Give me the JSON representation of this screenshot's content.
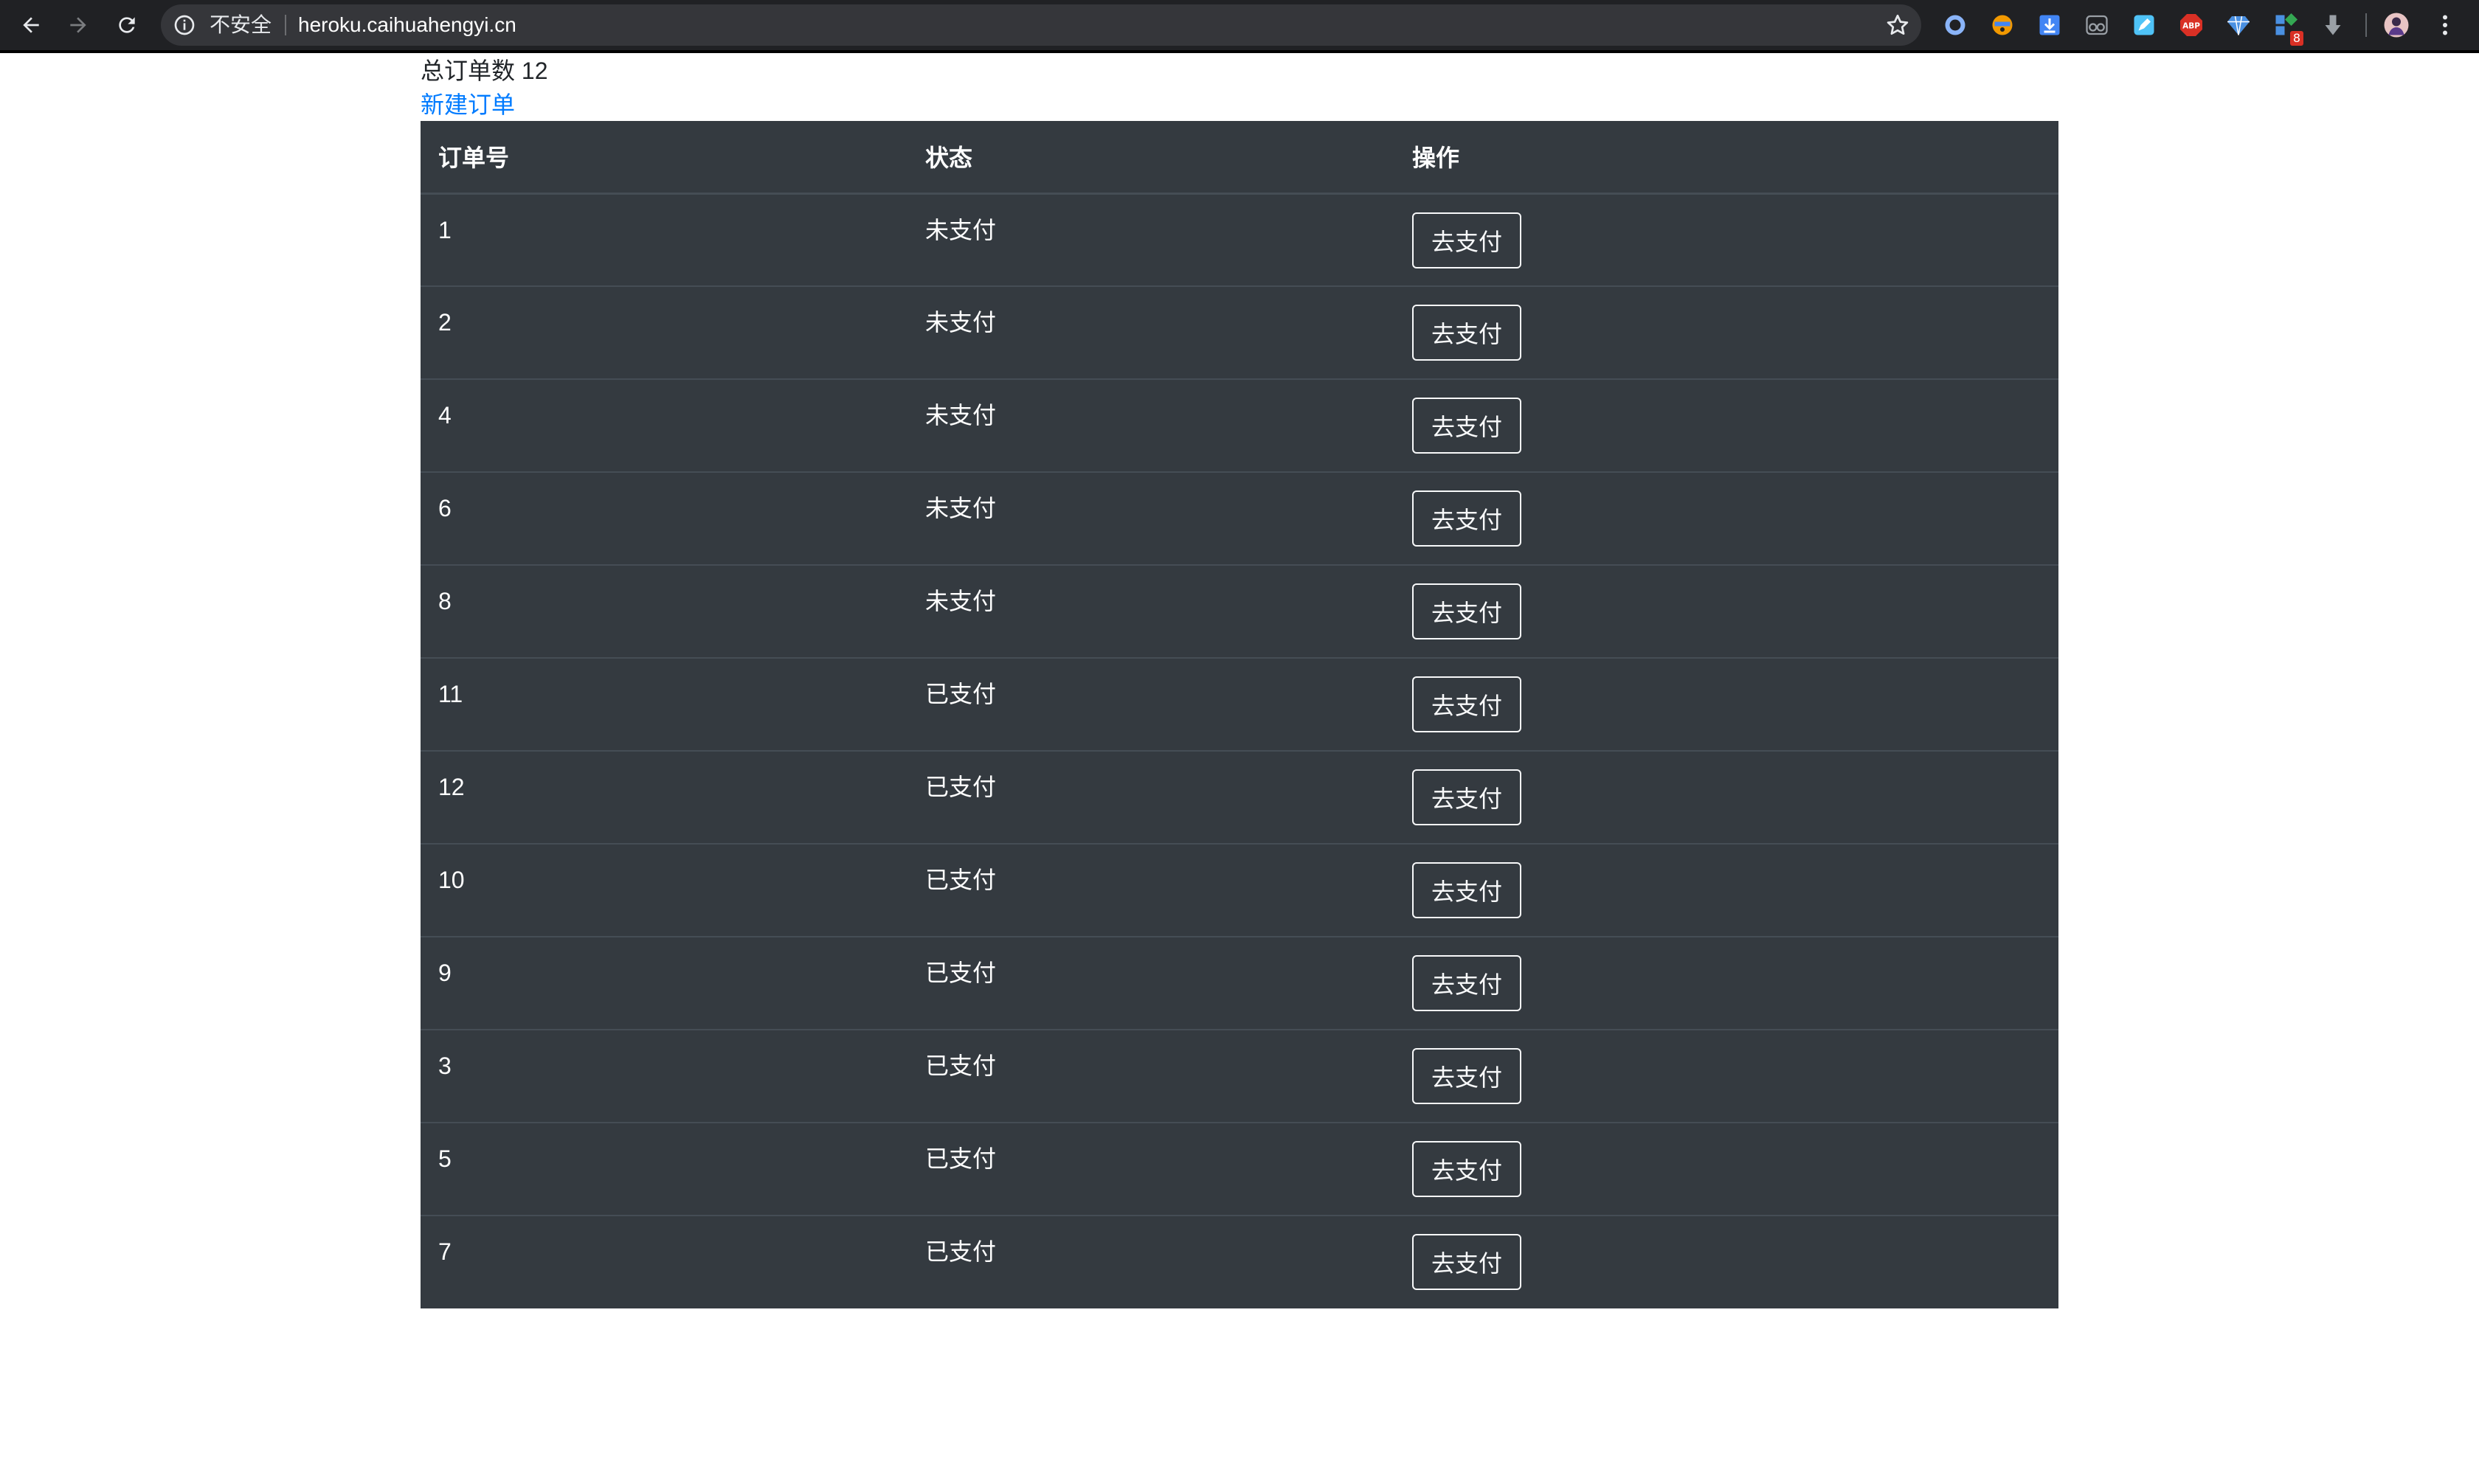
{
  "browser": {
    "security_label": "不安全",
    "url": "heroku.caihuahengyi.cn",
    "extension_badge": "8",
    "extensions": [
      {
        "name": "circle-extension-icon",
        "color": "#8ab4f8"
      },
      {
        "name": "emoji-extension-icon",
        "color": "#f29900"
      },
      {
        "name": "download-extension-icon",
        "color": "#4285f4"
      },
      {
        "name": "glasses-extension-icon",
        "color": "#9aa0a6"
      },
      {
        "name": "pen-extension-icon",
        "color": "#4fc3f7"
      },
      {
        "name": "adblock-extension-icon",
        "color": "#d93025"
      },
      {
        "name": "diamond-extension-icon",
        "color": "#4a90e2"
      },
      {
        "name": "grid-extension-icon",
        "color": "#4a90e2"
      },
      {
        "name": "arrow-down-extension-icon",
        "color": "#9aa0a6"
      }
    ]
  },
  "page": {
    "total_label": "总订单数 12",
    "new_order_link": "新建订单"
  },
  "table": {
    "headers": {
      "order_id": "订单号",
      "status": "状态",
      "action": "操作"
    },
    "rows": [
      {
        "id": "1",
        "status": "未支付",
        "action": "去支付"
      },
      {
        "id": "2",
        "status": "未支付",
        "action": "去支付"
      },
      {
        "id": "4",
        "status": "未支付",
        "action": "去支付"
      },
      {
        "id": "6",
        "status": "未支付",
        "action": "去支付"
      },
      {
        "id": "8",
        "status": "未支付",
        "action": "去支付"
      },
      {
        "id": "11",
        "status": "已支付",
        "action": "去支付"
      },
      {
        "id": "12",
        "status": "已支付",
        "action": "去支付"
      },
      {
        "id": "10",
        "status": "已支付",
        "action": "去支付"
      },
      {
        "id": "9",
        "status": "已支付",
        "action": "去支付"
      },
      {
        "id": "3",
        "status": "已支付",
        "action": "去支付"
      },
      {
        "id": "5",
        "status": "已支付",
        "action": "去支付"
      },
      {
        "id": "7",
        "status": "已支付",
        "action": "去支付"
      }
    ]
  },
  "colors": {
    "table_bg": "#343a40",
    "table_border": "#454d55",
    "link": "#007bff",
    "chrome_bg": "#202124"
  }
}
